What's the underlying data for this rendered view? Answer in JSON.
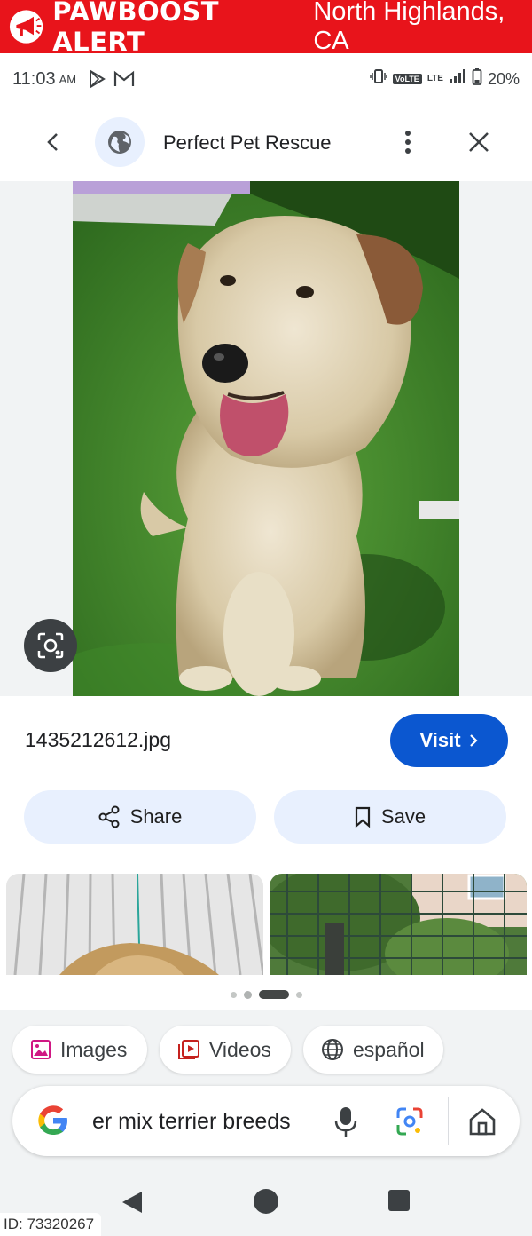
{
  "alert": {
    "brand": "PAWBOOST ALERT",
    "location": "North Highlands, CA",
    "icon": "megaphone-icon",
    "color": "#e8141b"
  },
  "status_bar": {
    "time": "11:03",
    "ampm": "AM",
    "network": "VoLTE",
    "lte": "LTE",
    "battery": "20%"
  },
  "header": {
    "site_name": "Perfect Pet Rescue"
  },
  "info": {
    "filename": "1435212612.jpg",
    "visit_label": "Visit",
    "share_label": "Share",
    "save_label": "Save",
    "accent": "#0b57d0"
  },
  "chips": [
    {
      "label": "Images",
      "icon": "image-icon"
    },
    {
      "label": "Videos",
      "icon": "video-icon"
    },
    {
      "label": "español",
      "icon": "globe-icon"
    }
  ],
  "search": {
    "query": "er mix terrier breeds"
  },
  "footer": {
    "id_label": "ID: 73320267"
  }
}
